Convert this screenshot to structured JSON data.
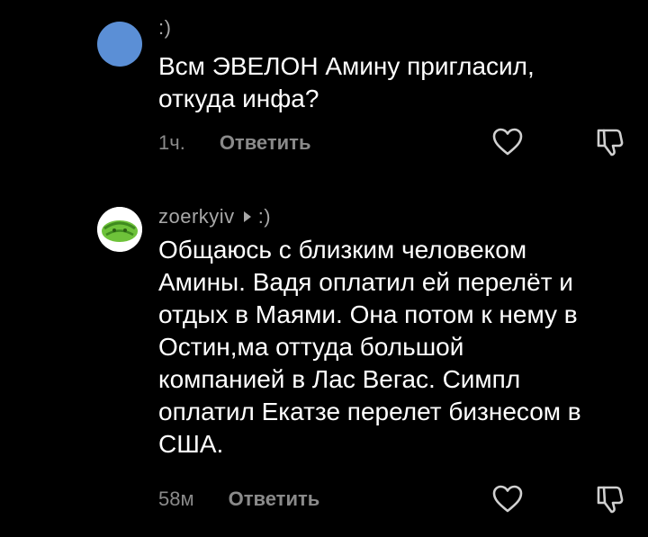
{
  "comments": [
    {
      "author": ":)",
      "text": "Всм ЭВЕЛОН Амину пригласил,\nоткуда инфа?",
      "time": "1ч.",
      "reply_label": "Ответить",
      "avatar_color": "#5b8fd6"
    },
    {
      "author": "zoerkyiv",
      "reply_to": ":)",
      "text": "Общаюсь с близким человеком\nАмины. Вадя оплатил ей перелёт и\nотдых в Маями. Она потом к нему в\nОстин,ма оттуда большой\nкомпанией в Лас Вегас. Симпл\nоплатил Екатзе перелет бизнесом в\nСША.",
      "time": "58м",
      "reply_label": "Ответить",
      "avatar_color": "#6ec23a"
    }
  ],
  "icons": {
    "like": "heart-outline-icon",
    "dislike": "thumbs-down-outline-icon"
  },
  "colors": {
    "background": "#000000",
    "text": "#ffffff",
    "muted": "#8a8a8a"
  }
}
